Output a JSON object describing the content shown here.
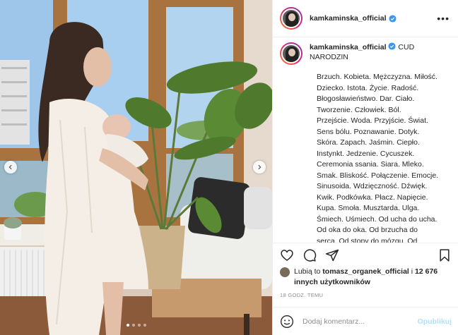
{
  "post": {
    "username": "kamkaminska_official",
    "verified": true,
    "more_icon": "more-horizontal-icon"
  },
  "caption": {
    "username": "kamkaminska_official",
    "title": "CUD NARODZIN",
    "body": "Brzuch. Kobieta. Mężczyzna. Miłość.\nDziecko. Istota. Życie. Radość.\nBłogosławieństwo. Dar. Ciało.\nTworzenie. Człowiek. Ból.\nPrzejście. Woda. Przyjście. Świat.\nSens bólu. Poznawanie. Dotyk.\nSkóra. Zapach. Jaśmin. Ciepło.\nInstynkt. Jedzenie. Cycuszek.\nCeremonia ssania. Siara. Mleko.\nSmak. Bliskość. Połączenie. Emocje.\nSinusoida. Wdzięczność. Dźwięk.\nKwik. Podkówka. Płacz. Napięcie.\nKupa. Smoła. Musztarda. Ulga.\nŚmiech. Uśmiech. Od ucha do ucha.\nOd oka do oka. Od brzucha do\nserca. Od stopy do mózgu. Od"
  },
  "actions": {
    "like_icon": "heart-icon",
    "comment_icon": "comment-icon",
    "share_icon": "share-icon",
    "save_icon": "bookmark-icon"
  },
  "likes": {
    "prefix": "Lubią to ",
    "user": "tomasz_organek_official",
    "connector": " i ",
    "count": "12 676 innych użytkowników"
  },
  "timestamp": "18 GODZ. TEMU",
  "comment": {
    "placeholder": "Dodaj komentarz...",
    "publish_label": "Opublikuj",
    "emoji_icon": "emoji-icon"
  },
  "carousel": {
    "total": 4,
    "active_index": 0
  },
  "colors": {
    "verified": "#3897f0",
    "publish_disabled": "#b2dffc",
    "divider": "#efefef"
  }
}
